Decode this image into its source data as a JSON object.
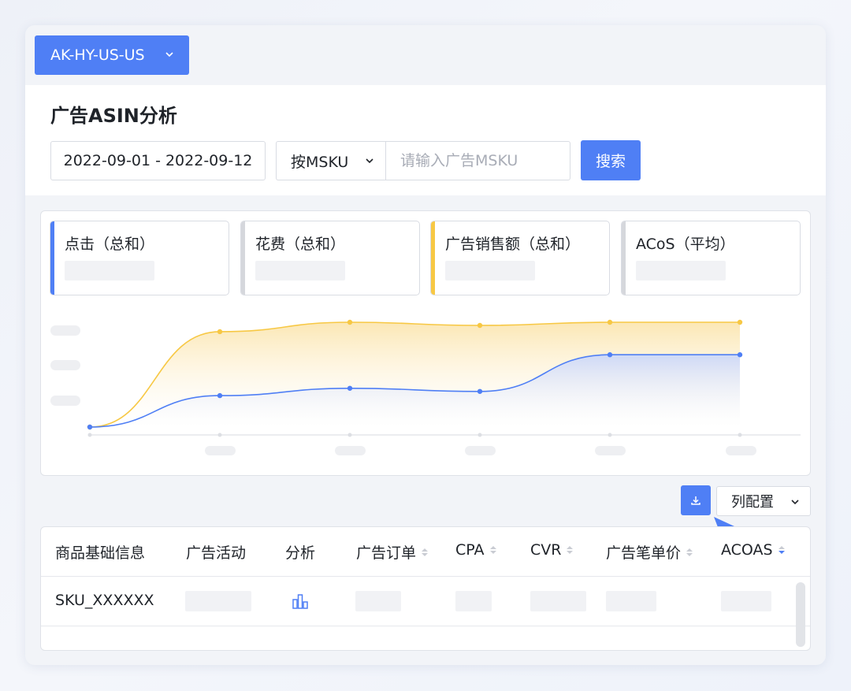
{
  "account": {
    "label": "AK-HY-US-US"
  },
  "page": {
    "title": "广告ASIN分析"
  },
  "filters": {
    "date_range": "2022-09-01 - 2022-09-12",
    "mode_label": "按MSKU",
    "sku_placeholder": "请输入广告MSKU",
    "search_label": "搜索"
  },
  "metrics": [
    {
      "label": "点击（总和）",
      "accent": "#4f7ff5"
    },
    {
      "label": "花费（总和）",
      "accent": "#d5d7dc"
    },
    {
      "label": "广告销售额（总和）",
      "accent": "#f7c844"
    },
    {
      "label": "ACoS（平均）",
      "accent": "#d5d7dc"
    }
  ],
  "chart_data": {
    "type": "area",
    "x": [
      1,
      2,
      3,
      4,
      5,
      6
    ],
    "series": [
      {
        "values": [
          0,
          0.91,
          1.0,
          0.97,
          1.0,
          1.0
        ],
        "color": "#f7c844"
      },
      {
        "values": [
          0,
          0.3,
          0.37,
          0.34,
          0.69,
          0.69
        ],
        "color": "#4f7ff5"
      }
    ],
    "grid": false
  },
  "toolbar": {
    "column_config_label": "列配置"
  },
  "table": {
    "headers": [
      {
        "label": "商品基础信息",
        "sortable": false
      },
      {
        "label": "广告活动",
        "sortable": false
      },
      {
        "label": "分析",
        "sortable": false
      },
      {
        "label": "广告订单",
        "sortable": true
      },
      {
        "label": "CPA",
        "sortable": true
      },
      {
        "label": "CVR",
        "sortable": true
      },
      {
        "label": "广告笔单价",
        "sortable": true
      },
      {
        "label": "ACOAS",
        "sortable": true,
        "active": true
      }
    ],
    "rows": [
      {
        "sku": "SKU_XXXXXX"
      }
    ]
  },
  "icons": [
    "chevron-down-icon",
    "download-icon",
    "bar-chart-icon",
    "cursor-arrow-icon"
  ]
}
